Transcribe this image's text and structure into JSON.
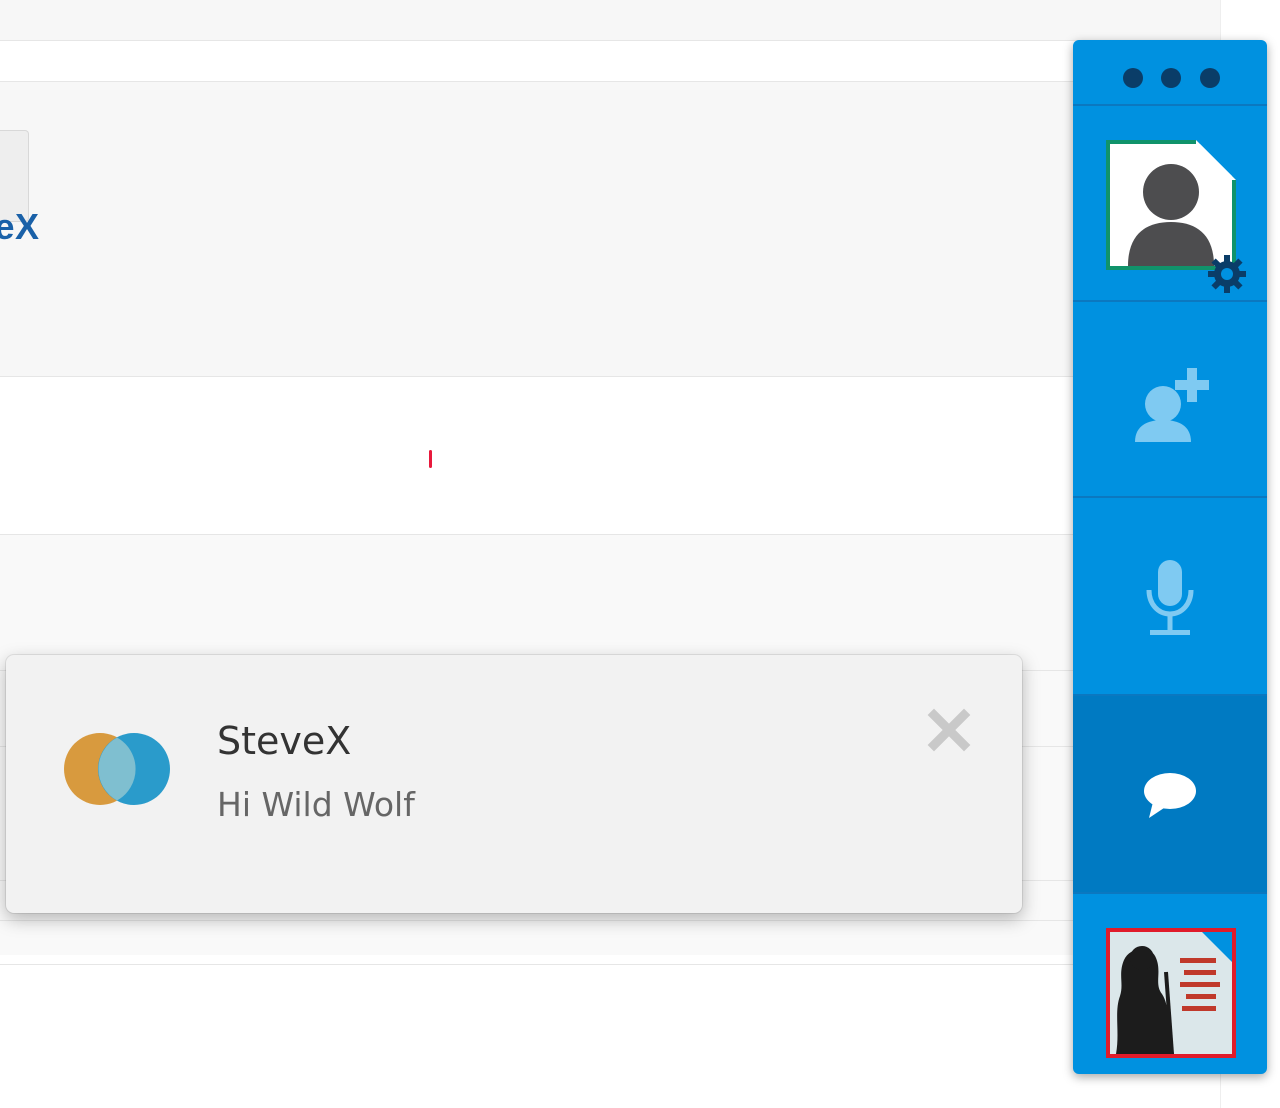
{
  "background": {
    "partial_name": "veX"
  },
  "notification": {
    "sender": "SteveX",
    "message": "Hi Wild Wolf",
    "close_icon": "close-icon",
    "app_logo_colors": [
      "#d89a3e",
      "#2a9bcb"
    ]
  },
  "sidebar": {
    "menu_icon": "more-dots-icon",
    "items": [
      {
        "icon": "user-avatar-icon",
        "settings_icon": "gear-icon"
      },
      {
        "icon": "add-contact-icon"
      },
      {
        "icon": "microphone-icon"
      },
      {
        "icon": "chat-bubble-icon",
        "active": true
      },
      {
        "icon": "contact-avatar-image"
      }
    ],
    "colors": {
      "background": "#0091e0",
      "active": "#007ac2",
      "separator": "#0b78c0",
      "own_avatar_border": "#10936b",
      "contact_avatar_border": "#e01b2a"
    }
  }
}
